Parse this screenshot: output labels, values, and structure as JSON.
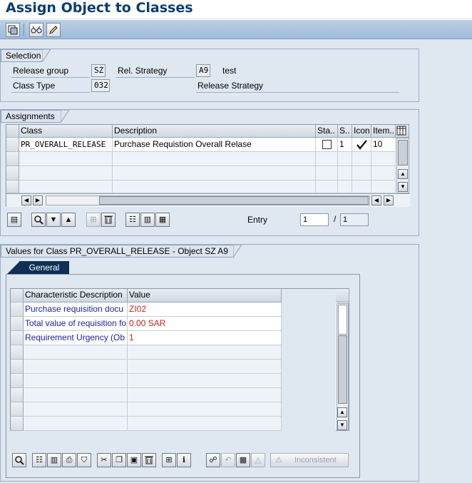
{
  "window": {
    "title": "Assign Object to Classes"
  },
  "toolbar": {
    "buttons": [
      {
        "icon": "object-structure-icon"
      },
      {
        "icon": "display-icon"
      },
      {
        "icon": "change-pencil-icon"
      }
    ]
  },
  "selection": {
    "title": "Selection",
    "release_group_label": "Release group",
    "release_group_value": "SZ",
    "rel_strategy_label": "Rel. Strategy",
    "rel_strategy_value": "A9",
    "rel_strategy_desc": "test",
    "class_type_label": "Class Type",
    "class_type_value": "032",
    "class_type_desc": "Release Strategy"
  },
  "assignments": {
    "title": "Assignments",
    "columns": [
      "Class",
      "Description",
      "Sta..",
      "S..",
      "Icon",
      "Item.."
    ],
    "rows": [
      {
        "class": "PR_OVERALL_RELEASE",
        "description": "Purchase Requistion Overall Relase",
        "status_checked": false,
        "s": "1",
        "icon": "checkmark-icon",
        "item": "10"
      }
    ],
    "entry_label": "Entry",
    "entry_value": "1",
    "entry_separator": "/",
    "entry_total": "1"
  },
  "values": {
    "title": "Values for Class PR_OVERALL_RELEASE - Object SZ A9",
    "tab_general": "General",
    "columns": [
      "Characteristic Description",
      "Value"
    ],
    "rows": [
      {
        "name": "Purchase requisition docu",
        "value": "ZI02"
      },
      {
        "name": "Total value of requisition fo",
        "value": "0.00 SAR"
      },
      {
        "name": "Requirement Urgency (Ob",
        "value": "1"
      }
    ],
    "inconsistent_label": "Inconsistent"
  },
  "colors": {
    "title_text": "#0a3d73",
    "characteristic_name": "#1a24a8",
    "characteristic_value": "#c2271a",
    "tab_active": "#0f2f56"
  }
}
